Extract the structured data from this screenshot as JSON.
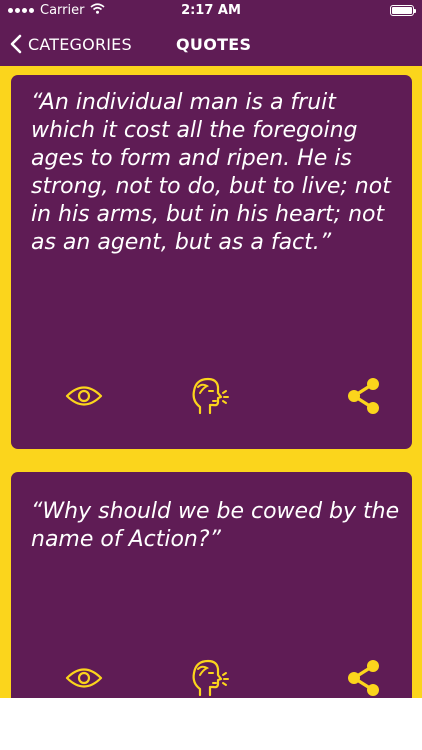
{
  "status_bar": {
    "carrier": "Carrier",
    "time": "2:17 AM",
    "battery_level": 1.0
  },
  "nav": {
    "back_label": "CATEGORIES",
    "title": "QUOTES"
  },
  "colors": {
    "brand_purple": "#5f1c55",
    "accent_yellow": "#fbd51c"
  },
  "quotes": [
    {
      "text": "“An individual man is a fruit which it cost all the foregoing ages to form and ripen. He is strong, not to do, but to live; not in his arms, but in his heart; not as an agent, but as a fact.”"
    },
    {
      "text": "“Why should we be cowed by the name of Action?”"
    }
  ],
  "card_actions": {
    "icons": [
      "eye-icon",
      "speaking-head-icon",
      "share-icon"
    ]
  }
}
